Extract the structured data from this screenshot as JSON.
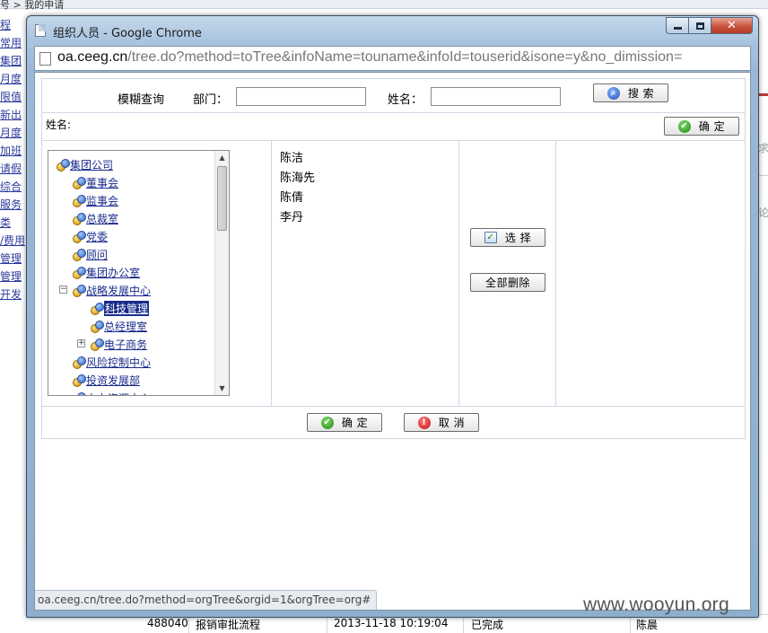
{
  "background": {
    "breadcrumb": "号 > 我的申请",
    "left_links": [
      "程",
      "常用",
      "集团",
      "月度",
      "限值",
      "新出",
      "月度",
      "加班",
      "请假",
      "综合",
      "服务",
      "类",
      "/费用",
      "管理",
      "管理",
      "开发"
    ],
    "right_snippets": [
      "求",
      "论"
    ],
    "bottom_row": {
      "id": "488040",
      "name": "报销审批流程",
      "time": "2013-11-18 10:19:04",
      "status": "已完成",
      "person": "陈晨"
    }
  },
  "window": {
    "title": "组织人员 - Google Chrome",
    "close_glyph": "✕",
    "address_host": "oa.ceeg.cn",
    "address_path": "/tree.do?method=toTree&infoName=touname&infoId=touserid&isone=y&no_dimission=",
    "status_url": "oa.ceeg.cn/tree.do?method=orgTree&orgid=1&orgTree=org#"
  },
  "form": {
    "search_title": "模糊查询",
    "dept_label": "部门：",
    "name_label": "姓名：",
    "dept_value": "",
    "name_value": "",
    "search_button": "搜 索",
    "selected_label": "姓名:",
    "confirm_top": "确 定",
    "select_button": "选 择",
    "delete_all_button": "全部删除",
    "confirm_bottom": "确 定",
    "cancel_button": "取 消"
  },
  "tree": [
    {
      "label": "集团公司",
      "level": 0
    },
    {
      "label": "董事会",
      "level": 1
    },
    {
      "label": "监事会",
      "level": 1
    },
    {
      "label": "总裁室",
      "level": 1
    },
    {
      "label": "党委",
      "level": 1
    },
    {
      "label": "顾问",
      "level": 1
    },
    {
      "label": "集团办公室",
      "level": 1
    },
    {
      "label": "战略发展中心",
      "level": 1,
      "toggle": "−"
    },
    {
      "label": "科技管理",
      "level": 2,
      "selected": true
    },
    {
      "label": "总经理室",
      "level": 2
    },
    {
      "label": "电子商务",
      "level": 2,
      "toggle": "+"
    },
    {
      "label": "风险控制中心",
      "level": 1
    },
    {
      "label": "投资发展部",
      "level": 1
    },
    {
      "label": "人力资源中心",
      "level": 1
    }
  ],
  "names": [
    "陈洁",
    "陈海先",
    "陈倩",
    "李丹"
  ],
  "watermark": "www.wooyun.org"
}
